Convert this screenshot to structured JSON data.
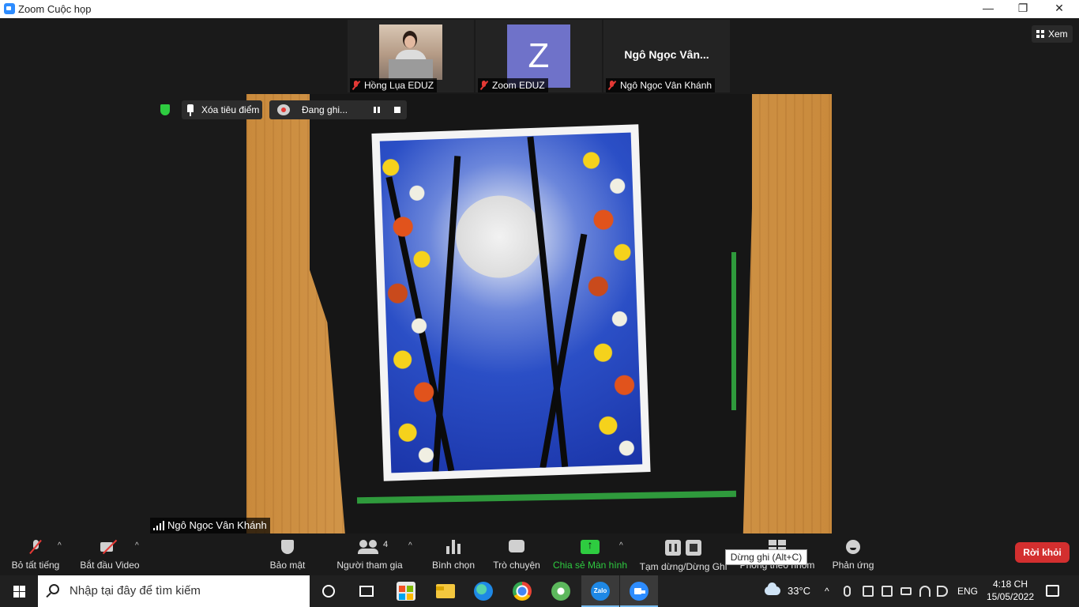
{
  "window": {
    "title": "Zoom Cuộc họp",
    "minimize": "—",
    "maximize": "❐",
    "close": "✕"
  },
  "view_button": {
    "label": "Xem"
  },
  "thumbnails": [
    {
      "name": "Hồng Lụa  EDUZ",
      "type": "photo"
    },
    {
      "name": "Zoom EDUZ",
      "type": "avatar",
      "initial": "Z"
    },
    {
      "name": "Ngô Ngọc Vân Khánh",
      "type": "text",
      "big_name": "Ngô  Ngọc  Vân..."
    }
  ],
  "video_controls": {
    "unspotlight": "Xóa tiêu điểm",
    "recording": "Đang ghi..."
  },
  "active_speaker": "Ngô Ngọc Vân Khánh",
  "toolbar": {
    "mute": "Bỏ tất tiếng",
    "video": "Bắt đầu Video",
    "security": "Bảo mật",
    "participants": "Người tham gia",
    "participants_count": "4",
    "polls": "Bình chọn",
    "chat": "Trò chuyện",
    "share": "Chia sẻ Màn hình",
    "record": "Tạm dừng/Dừng Ghi",
    "breakout": "Phòng theo nhóm",
    "reactions": "Phản ứng",
    "leave": "Rời khỏi",
    "tooltip": "Dừng ghi (Alt+C)",
    "caret": "^",
    "share_color": "#2ecc40",
    "leave_color": "#d32f2f"
  },
  "taskbar": {
    "search_placeholder": "Nhập tại đây để tìm kiếm",
    "zalo_label": "Zalo",
    "weather": "33°C",
    "tray_expand": "^",
    "language": "ENG",
    "time": "4:18 CH",
    "date": "15/05/2022"
  }
}
